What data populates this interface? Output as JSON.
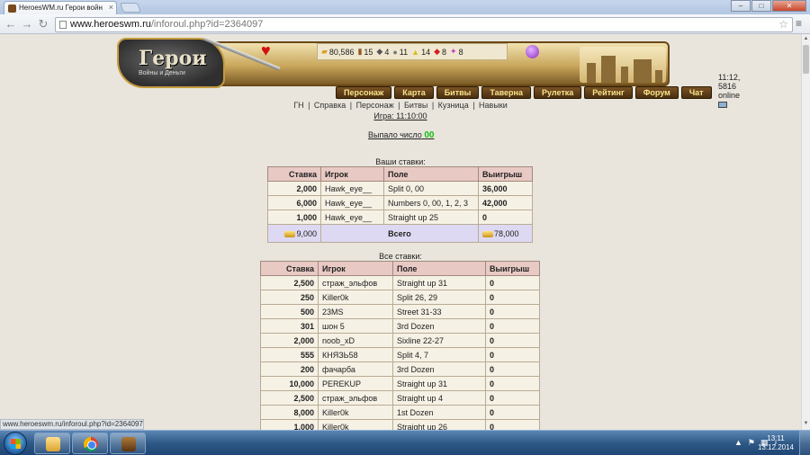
{
  "browser": {
    "tab_title": "HeroesWM.ru Герои войн",
    "url_host": "www.heroeswm.ru",
    "url_path": "/inforoul.php?id=2364097",
    "status_url": "www.heroeswm.ru/inforoul.php?id=2364097"
  },
  "header": {
    "logo_title": "Герои",
    "logo_sub": "Войны и Деньги",
    "online_text": "11:12, 5816 online",
    "resources": [
      {
        "icon": "gold-icon",
        "value": "80,586"
      },
      {
        "icon": "wood-icon",
        "value": "15"
      },
      {
        "icon": "ore-icon",
        "value": "4"
      },
      {
        "icon": "mercury-icon",
        "value": "11"
      },
      {
        "icon": "sulfur-icon",
        "value": "14"
      },
      {
        "icon": "crystal-icon",
        "value": "8"
      },
      {
        "icon": "gems-icon",
        "value": "8"
      }
    ],
    "nav": [
      "Персонаж",
      "Карта",
      "Битвы",
      "Таверна",
      "Рулетка",
      "Рейтинг",
      "Форум",
      "Чат"
    ]
  },
  "sublinks": [
    "ГН",
    "Справка",
    "Персонаж",
    "Битвы",
    "Кузница",
    "Навыки"
  ],
  "game_time": "Игра: 11:10:00",
  "dropped": {
    "label": "Выпало число",
    "number": "00"
  },
  "your_bets": {
    "caption": "Ваши ставки:",
    "headers": [
      "Ставка",
      "Игрок",
      "Поле",
      "Выигрыш"
    ],
    "rows": [
      {
        "stake": "2,000",
        "player": "Hawk_eye__",
        "field": "Split 0, 00",
        "win": "36,000"
      },
      {
        "stake": "6,000",
        "player": "Hawk_eye__",
        "field": "Numbers 0, 00, 1, 2, 3",
        "win": "42,000"
      },
      {
        "stake": "1,000",
        "player": "Hawk_eye__",
        "field": "Straight up 25",
        "win": "0"
      }
    ],
    "total": {
      "stake": "9,000",
      "label": "Всего",
      "win": "78,000"
    }
  },
  "all_bets": {
    "caption": "Все ставки:",
    "headers": [
      "Ставка",
      "Игрок",
      "Поле",
      "Выигрыш"
    ],
    "rows": [
      {
        "stake": "2,500",
        "player": "страж_эльфов",
        "field": "Straight up 31",
        "win": "0"
      },
      {
        "stake": "250",
        "player": "Killer0k",
        "field": "Split 26, 29",
        "win": "0"
      },
      {
        "stake": "500",
        "player": "23MS",
        "field": "Street 31-33",
        "win": "0"
      },
      {
        "stake": "301",
        "player": "шон 5",
        "field": "3rd Dozen",
        "win": "0"
      },
      {
        "stake": "2,000",
        "player": "noob_xD",
        "field": "Sixline 22-27",
        "win": "0"
      },
      {
        "stake": "555",
        "player": "КНЯЗЬ58",
        "field": "Split 4, 7",
        "win": "0"
      },
      {
        "stake": "200",
        "player": "фачарба",
        "field": "3rd Dozen",
        "win": "0"
      },
      {
        "stake": "10,000",
        "player": "PEREKUP",
        "field": "Straight up 31",
        "win": "0"
      },
      {
        "stake": "2,500",
        "player": "страж_эльфов",
        "field": "Straight up 4",
        "win": "0"
      },
      {
        "stake": "8,000",
        "player": "Killer0k",
        "field": "1st Dozen",
        "win": "0"
      },
      {
        "stake": "1,000",
        "player": "Killer0k",
        "field": "Straight up 26",
        "win": "0"
      }
    ]
  },
  "taskbar": {
    "time": "13:11",
    "date": "13.12.2014"
  },
  "colors": {
    "accent_header": "#e8c9c4",
    "total_row": "#ded9f3",
    "dropped_number": "#10c010"
  }
}
